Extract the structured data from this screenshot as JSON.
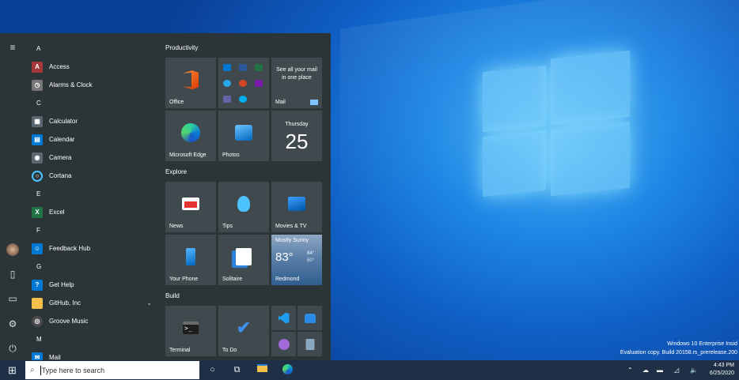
{
  "desktop": {
    "watermark_line1": "Windows 10 Enterprise Insid",
    "watermark_line2": "Evaluation copy. Build 20158.rs_prerelease.200"
  },
  "start_menu": {
    "app_list": [
      {
        "type": "letter",
        "text": "A"
      },
      {
        "type": "app",
        "label": "Access",
        "icon": "access-icon",
        "color": "#a4373a",
        "glyph": "A"
      },
      {
        "type": "app",
        "label": "Alarms & Clock",
        "icon": "alarms-clock-icon",
        "color": "#777777",
        "glyph": "◷"
      },
      {
        "type": "letter",
        "text": "C"
      },
      {
        "type": "app",
        "label": "Calculator",
        "icon": "calculator-icon",
        "color": "#5b6770",
        "glyph": "▦"
      },
      {
        "type": "app",
        "label": "Calendar",
        "icon": "calendar-icon",
        "color": "#0078d4",
        "glyph": "▤"
      },
      {
        "type": "app",
        "label": "Camera",
        "icon": "camera-icon",
        "color": "#5b6770",
        "glyph": "◉"
      },
      {
        "type": "app",
        "label": "Cortana",
        "icon": "cortana-icon",
        "color": "transparent",
        "glyph": "○"
      },
      {
        "type": "letter",
        "text": "E"
      },
      {
        "type": "app",
        "label": "Excel",
        "icon": "excel-icon",
        "color": "#217346",
        "glyph": "X"
      },
      {
        "type": "letter",
        "text": "F"
      },
      {
        "type": "app",
        "label": "Feedback Hub",
        "icon": "feedback-hub-icon",
        "color": "#0078d4",
        "glyph": "☺"
      },
      {
        "type": "letter",
        "text": "G"
      },
      {
        "type": "app",
        "label": "Get Help",
        "icon": "get-help-icon",
        "color": "#0078d4",
        "glyph": "?"
      },
      {
        "type": "app",
        "label": "GitHub, Inc",
        "icon": "folder-icon",
        "color": "#f4c04a",
        "glyph": "",
        "expandable": true
      },
      {
        "type": "app",
        "label": "Groove Music",
        "icon": "groove-music-icon",
        "color": "#4a4a4a",
        "glyph": "◎"
      },
      {
        "type": "letter",
        "text": "M"
      },
      {
        "type": "app",
        "label": "Mail",
        "icon": "mail-icon",
        "color": "#0078d4",
        "glyph": "✉"
      }
    ],
    "groups": {
      "productivity": "Productivity",
      "explore": "Explore",
      "build": "Build"
    },
    "tiles": {
      "office": "Office",
      "mail_tile_text": "See all your mail in one place",
      "mail": "Mail",
      "edge": "Microsoft Edge",
      "photos": "Photos",
      "calendar_day": "Thursday",
      "calendar_date": "25",
      "news": "News",
      "tips": "Tips",
      "movies": "Movies & TV",
      "your_phone": "Your Phone",
      "solitaire": "Solitaire",
      "weather_condition": "Mostly Sunny",
      "weather_temp": "83°",
      "weather_high": "84°",
      "weather_low": "60°",
      "weather_city": "Redmond",
      "terminal": "Terminal",
      "todo": "To Do"
    }
  },
  "taskbar": {
    "search_placeholder": "Type here to search",
    "time": "4:43 PM",
    "date": "6/25/2020"
  }
}
